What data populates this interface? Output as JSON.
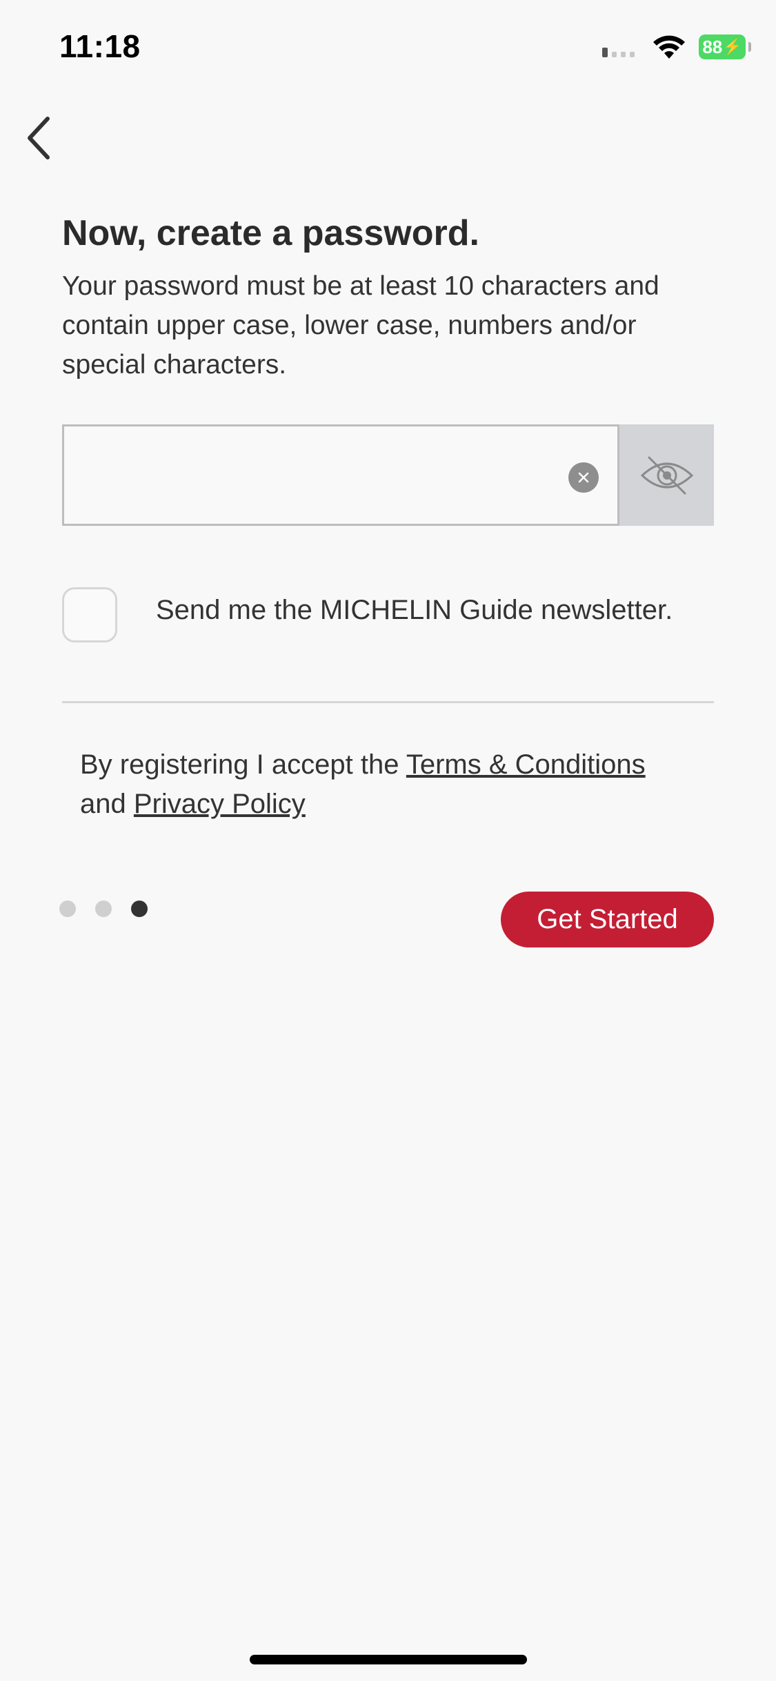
{
  "status_bar": {
    "time": "11:18",
    "battery_level": "88",
    "battery_color": "#4cd964",
    "icons": [
      "cellular-signal-icon",
      "wifi-icon",
      "battery-charging-icon"
    ]
  },
  "navigation": {
    "back_icon": "chevron-left-icon"
  },
  "header": {
    "title": "Now, create a password.",
    "description": "Your password must be at least 10 characters and contain upper case, lower case, numbers and/or special characters."
  },
  "password_field": {
    "value": "",
    "placeholder": "",
    "clear_icon": "clear-icon",
    "visibility_icon": "eye-slash-icon"
  },
  "newsletter": {
    "label": "Send me the MICHELIN Guide newsletter.",
    "checked": false
  },
  "terms": {
    "prefix": "By registering I accept the ",
    "terms_link": "Terms & Conditions",
    "middle": "and ",
    "privacy_link": "Privacy Policy"
  },
  "pagination": {
    "total": 3,
    "current": 3
  },
  "actions": {
    "get_started_label": "Get Started",
    "accent_color": "#c41e34"
  }
}
